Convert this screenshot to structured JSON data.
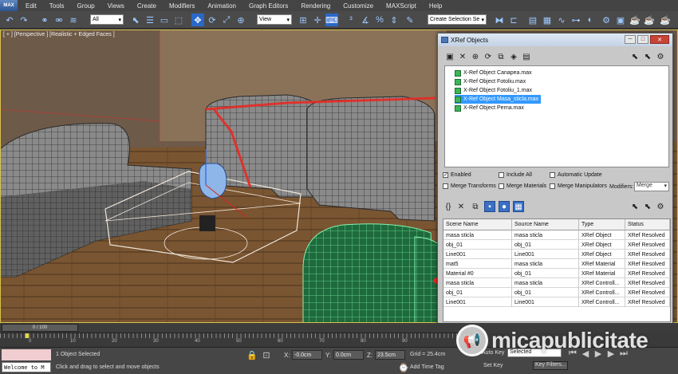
{
  "menubar": {
    "max_label": "MAX",
    "items": [
      "Edit",
      "Tools",
      "Group",
      "Views",
      "Create",
      "Modifiers",
      "Animation",
      "Graph Editors",
      "Rendering",
      "Customize",
      "MAXScript",
      "Help"
    ]
  },
  "toolbar": {
    "filter_value": "All",
    "refcoord_value": "View",
    "selection_set_placeholder": "Create Selection Se"
  },
  "viewport": {
    "label": "[ + ] [Perspective ] [Realistic + Edged Faces ]"
  },
  "xref_dialog": {
    "title": "XRef Objects",
    "files": [
      {
        "name": "X-Ref Object Canapea.max",
        "selected": false
      },
      {
        "name": "X-Ref Object Fotoliu.max",
        "selected": false
      },
      {
        "name": "X-Ref Object Fotoliu_1.max",
        "selected": false
      },
      {
        "name": "X-Ref Object Masa_sticla.max",
        "selected": true
      },
      {
        "name": "X-Ref Object Perna.max",
        "selected": false
      }
    ],
    "options": {
      "enabled": "Enabled",
      "include_all": "Include All",
      "automatic_update": "Automatic Update",
      "merge_transforms": "Merge Transforms",
      "merge_materials": "Merge Materials",
      "merge_manipulators": "Merge Manipulators",
      "modifiers_label": "Modifiers:",
      "modifiers_value": "Merge"
    },
    "table": {
      "headers": [
        "Scene Name",
        "Source Name",
        "Type",
        "Status"
      ],
      "rows": [
        [
          "masa sticla",
          "masa sticla",
          "XRef Object",
          "XRef Resolved"
        ],
        [
          "obj_01",
          "obj_01",
          "XRef Object",
          "XRef Resolved"
        ],
        [
          "Line001",
          "Line001",
          "XRef Object",
          "XRef Resolved"
        ],
        [
          "mat5",
          "masa sticla",
          "XRef Material",
          "XRef Resolved"
        ],
        [
          "Material #0",
          "obj_01",
          "XRef Material",
          "XRef Resolved"
        ],
        [
          "masa sticla",
          "masa sticla",
          "XRef Controll...",
          "XRef Resolved"
        ],
        [
          "obj_01",
          "obj_01",
          "XRef Controll...",
          "XRef Resolved"
        ],
        [
          "Line001",
          "Line001",
          "XRef Controll...",
          "XRef Resolved"
        ]
      ]
    }
  },
  "timeline": {
    "slider_label": "0 / 100",
    "ticks": [
      "0",
      "10",
      "20",
      "30",
      "40",
      "50",
      "60",
      "70",
      "80",
      "90"
    ]
  },
  "statusbar": {
    "maxscript_text": "Welcome to M",
    "selected_text": "1 Object Selected",
    "prompt_text": "Click and drag to select and move objects",
    "x_label": "X:",
    "x_value": "-0.0cm",
    "y_label": "Y:",
    "y_value": "0.0cm",
    "z_label": "Z:",
    "z_value": "23.5cm",
    "grid_text": "Grid = 25.4cm",
    "add_time_tag": "Add Time Tag"
  },
  "anim_controls": {
    "auto_key": "Auto Key",
    "auto_key_value": "Selected",
    "set_key": "Set Key",
    "key_filters": "Key Filters..."
  },
  "watermark": {
    "text": "micapublicitate"
  }
}
